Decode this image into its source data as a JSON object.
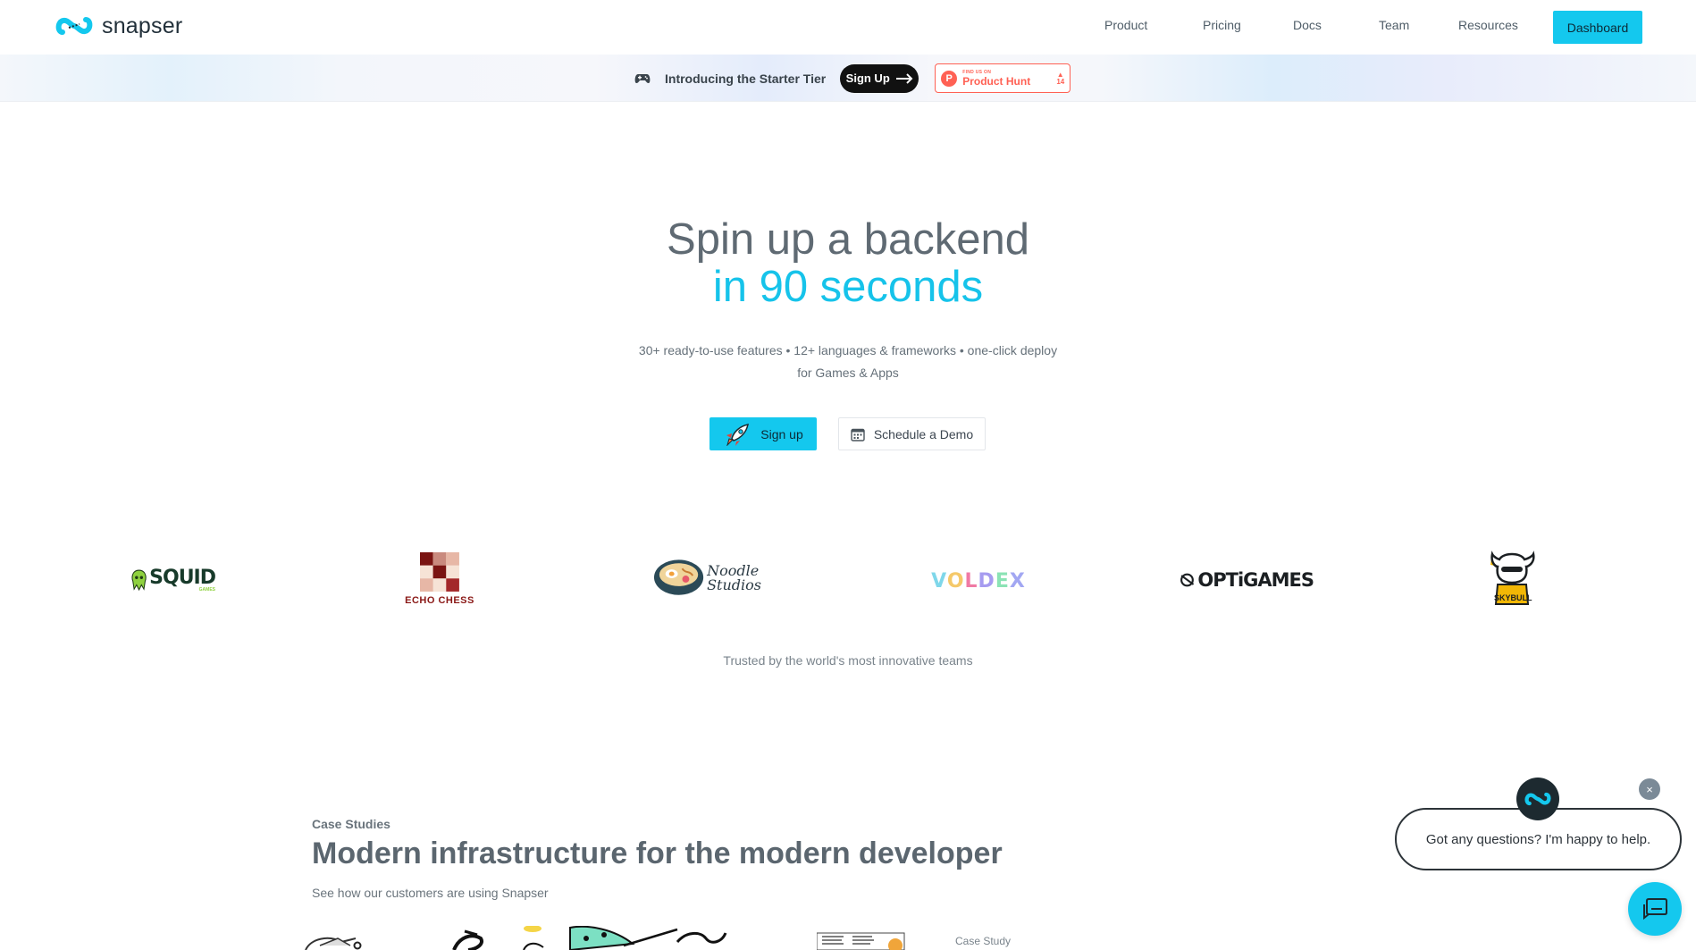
{
  "nav": {
    "brand": "snapser",
    "links": [
      "Product",
      "Pricing",
      "Docs",
      "Team",
      "Resources"
    ],
    "dashboard_label": "Dashboard"
  },
  "banner": {
    "text": "Introducing the Starter Tier",
    "signup_label": "Sign Up",
    "product_hunt": {
      "small": "FIND US ON",
      "big": "Product Hunt",
      "votes": "14"
    }
  },
  "hero": {
    "title_line1": "Spin up a backend",
    "title_line2": "in 90 seconds",
    "subtitle_line1": "30+ ready-to-use features • 12+ languages & frameworks • one-click deploy",
    "subtitle_line2": "for Games & Apps",
    "signup_label": "Sign up",
    "demo_label": "Schedule a Demo"
  },
  "logos": {
    "squid": "SQUID",
    "squid_small": "GAMES",
    "echo": "ECHO CHESS",
    "noodle1": "Noodle",
    "noodle2": "Studios",
    "voldex": "VOLDEX",
    "optigames": "OPTiGAMES",
    "skybull": "SKYBULL",
    "trusted": "Trusted by the world's most innovative teams"
  },
  "case_studies": {
    "kicker": "Case Studies",
    "title": "Modern infrastructure for the modern developer",
    "subtitle": "See how our customers are using Snapser",
    "card_label": "Case Study"
  },
  "chat": {
    "message": "Got any questions? I'm happy to help.",
    "close": "×"
  },
  "colors": {
    "accent": "#14c8ee",
    "text_dark": "#5f6a73",
    "product_hunt": "#ff6154"
  }
}
